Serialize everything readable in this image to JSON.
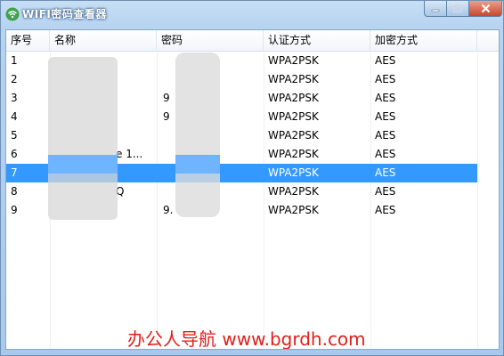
{
  "window": {
    "title": "WIFI密码查看器",
    "controls": {
      "minimize": "—",
      "maximize": "□",
      "close": "✕"
    }
  },
  "table": {
    "columns": [
      "序号",
      "名称",
      "密码",
      "认证方式",
      "加密方式"
    ],
    "rows": [
      {
        "index": "1",
        "name": "",
        "password": "",
        "auth": "WPA2PSK",
        "encryption": "AES"
      },
      {
        "index": "2",
        "name": "",
        "password": "",
        "auth": "WPA2PSK",
        "encryption": "AES"
      },
      {
        "index": "3",
        "name": "",
        "password": "9",
        "auth": "WPA2PSK",
        "encryption": "AES"
      },
      {
        "index": "4",
        "name": "",
        "password": "9",
        "auth": "WPA2PSK",
        "encryption": "AES"
      },
      {
        "index": "5",
        "name": "",
        "password": "",
        "auth": "WPA2PSK",
        "encryption": "AES"
      },
      {
        "index": "6",
        "name": "e 1...",
        "password": "",
        "auth": "WPA2PSK",
        "encryption": "AES"
      },
      {
        "index": "7",
        "name": "",
        "password": "",
        "auth": "WPA2PSK",
        "encryption": "AES"
      },
      {
        "index": "8",
        "name": "Q",
        "password": "",
        "auth": "WPA2PSK",
        "encryption": "AES"
      },
      {
        "index": "9",
        "name": "",
        "password": "9.",
        "auth": "WPA2PSK",
        "encryption": "AES"
      }
    ],
    "selected_row": 7
  },
  "watermark": "办公人导航 www.bgrdh.com",
  "colors": {
    "selection": "#3399ff",
    "watermark": "#e0201b",
    "title_glow": "#2a4f7a"
  },
  "icons": {
    "app": "wifi-icon"
  }
}
